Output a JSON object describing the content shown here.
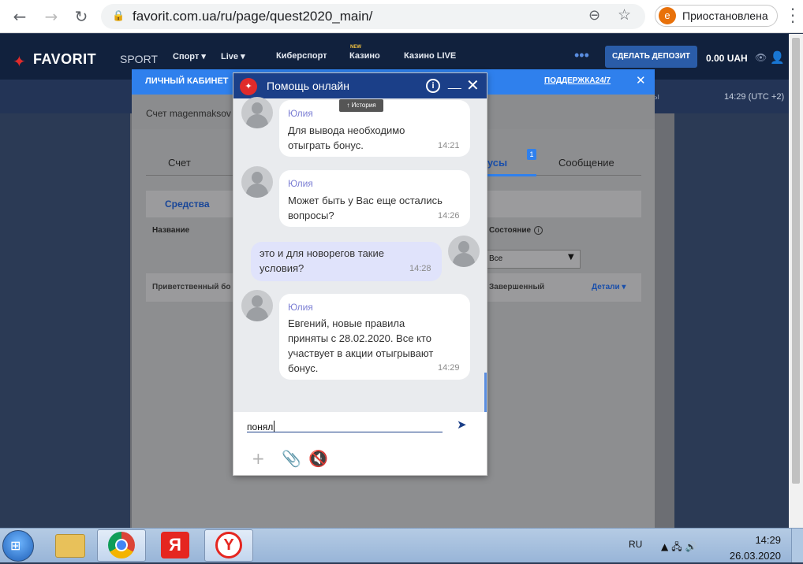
{
  "browser": {
    "url": "favorit.com.ua/ru/page/quest2020_main/",
    "profile_initial": "е",
    "profile_label": "Приостановлена"
  },
  "site": {
    "logo_main": "FAVORIT",
    "logo_sub": "SPORT",
    "nav": [
      {
        "label": "Спорт ▾"
      },
      {
        "label": "Live ▾"
      },
      {
        "label": "Киберспорт"
      },
      {
        "label": "Казино",
        "badge": "NEW"
      },
      {
        "label": "Казино LIVE"
      }
    ],
    "more": "•••",
    "deposit_label": "СДЕЛАТЬ ДЕПОЗИТ",
    "balance": "0.00 UAH",
    "subbar_text": "ы",
    "clock": "14:29 (UTC +2)"
  },
  "cabinet": {
    "title": "ЛИЧНЫЙ КАБИНЕТ",
    "support": "ПОДДЕРЖКА24/7",
    "account": "Счет magenmaksov",
    "tabs": {
      "account": "Счет",
      "bonuses": "нусы",
      "bonus_badge": "1",
      "messages": "Сообщение"
    },
    "subtab": "Средства",
    "columns": {
      "name": "Название",
      "state": "Состояние"
    },
    "filter_value": "Все",
    "row": {
      "name": "Приветственный бо",
      "state": "Завершенный",
      "details": "Детали ▾"
    }
  },
  "chat": {
    "title": "Помощь онлайн",
    "history": "↑ История",
    "messages": [
      {
        "author": "Юлия",
        "lines": [
          "Для вывода необходимо",
          "отыграть бонус."
        ],
        "time": "14:21",
        "mine": false
      },
      {
        "author": "Юлия",
        "lines": [
          "Может быть у Вас еще остались",
          "вопросы?"
        ],
        "time": "14:26",
        "mine": false
      },
      {
        "author": "",
        "lines": [
          "это и для новорегов такие",
          "условия?"
        ],
        "time": "14:28",
        "mine": true
      },
      {
        "author": "Юлия",
        "lines": [
          "Евгений, новые правила",
          "приняты с 28.02.2020. Все кто",
          "участвует в акции отыгрывают",
          "бонус."
        ],
        "time": "14:29",
        "mine": false
      }
    ],
    "input_value": "понял"
  },
  "taskbar": {
    "lang": "RU",
    "time": "14:29",
    "date": "26.03.2020",
    "yandex_letter": "Я",
    "ybrowser_letter": "Y"
  }
}
